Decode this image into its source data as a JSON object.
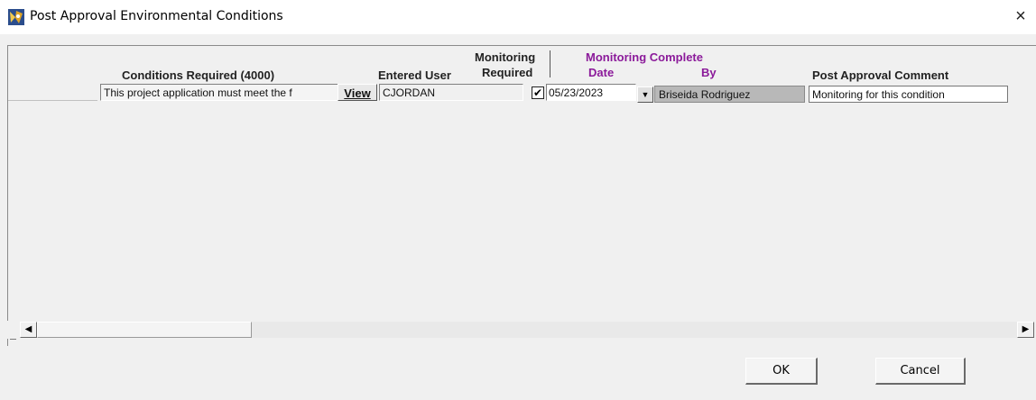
{
  "window": {
    "title": "Post Approval Environmental Conditions",
    "close_glyph": "×"
  },
  "grid": {
    "headers": {
      "conditions": "Conditions Required (4000)",
      "entered_user": "Entered User",
      "monitoring_line1": "Monitoring",
      "monitoring_line2": "Required",
      "monitoring_complete": "Monitoring Complete",
      "date": "Date",
      "by": "By",
      "comment": "Post Approval Comment"
    },
    "rows": [
      {
        "condition": "This project application must meet the f",
        "view_label": "View",
        "entered_user": "CJORDAN",
        "monitoring_required": true,
        "check_glyph": "✔",
        "date": "05/23/2023",
        "by": "Briseida  Rodriguez",
        "comment": "Monitoring for this condition"
      }
    ]
  },
  "scrollbar": {
    "left_arrow": "◀",
    "right_arrow": "▶"
  },
  "buttons": {
    "ok": "OK",
    "cancel": "Cancel"
  },
  "colors": {
    "accent_purple": "#8b1a9a",
    "dialog_bg": "#f0f0f0"
  }
}
